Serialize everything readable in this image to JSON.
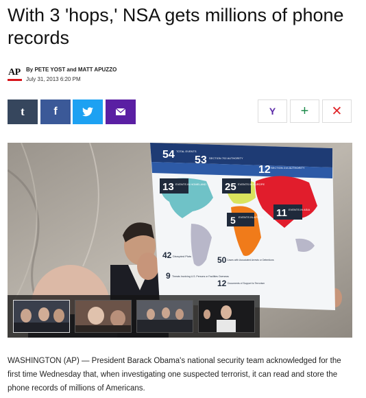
{
  "article": {
    "headline": "With 3 'hops,' NSA gets millions of phone records",
    "byline_names": "By PETE YOST and MATT APUZZO",
    "byline_date": "July 31, 2013 6:20 PM",
    "publisher_logo": "AP",
    "body_lead": "WASHINGTON (AP) — President Barack Obama's national security team acknowledged for the first time Wednesday that, when investigating one suspected terrorist, it can read and store the phone records of millions of Americans."
  },
  "share": {
    "tumblr_icon": "t",
    "facebook_icon": "f",
    "twitter_icon": "twitter-bird",
    "email_icon": "envelope",
    "colors": {
      "tumblr": "#36465d",
      "facebook": "#3b5998",
      "twitter": "#1da1f2",
      "email": "#5a1fa3"
    }
  },
  "actions": {
    "yahoo_label": "Y",
    "add_label": "+",
    "close_label": "✕"
  },
  "photo": {
    "poster_labels": {
      "total_events": "54",
      "total_events_label": "TOTAL EVENTS",
      "section_702": "53",
      "section_702_label": "SECTION 702 AUTHORITY",
      "section_215_count": "12",
      "section_215_label": "SECTION 215 AUTHORITY",
      "homeland": "13",
      "homeland_label": "EVENTS IN HOMELAND",
      "europe": "25",
      "europe_label": "EVENTS IN EUROPE",
      "africa": "5",
      "africa_label": "EVENTS IN AFRICA",
      "asia": "11",
      "asia_label": "EVENTS IN ASIA",
      "disrupted": "42",
      "disrupted_label": "Disrupted Plots",
      "associates": "50",
      "associates_label": "Cases with Associated Arrests or Detentions",
      "threats": "9",
      "threats_label": "Threats Involving U.S. Persons or Facilities Overseas",
      "documents": "12",
      "documents_label": "Documents of Support to Terrorism"
    }
  },
  "colors": {
    "accent_red": "#d7141a",
    "text": "#1a1a1a"
  }
}
